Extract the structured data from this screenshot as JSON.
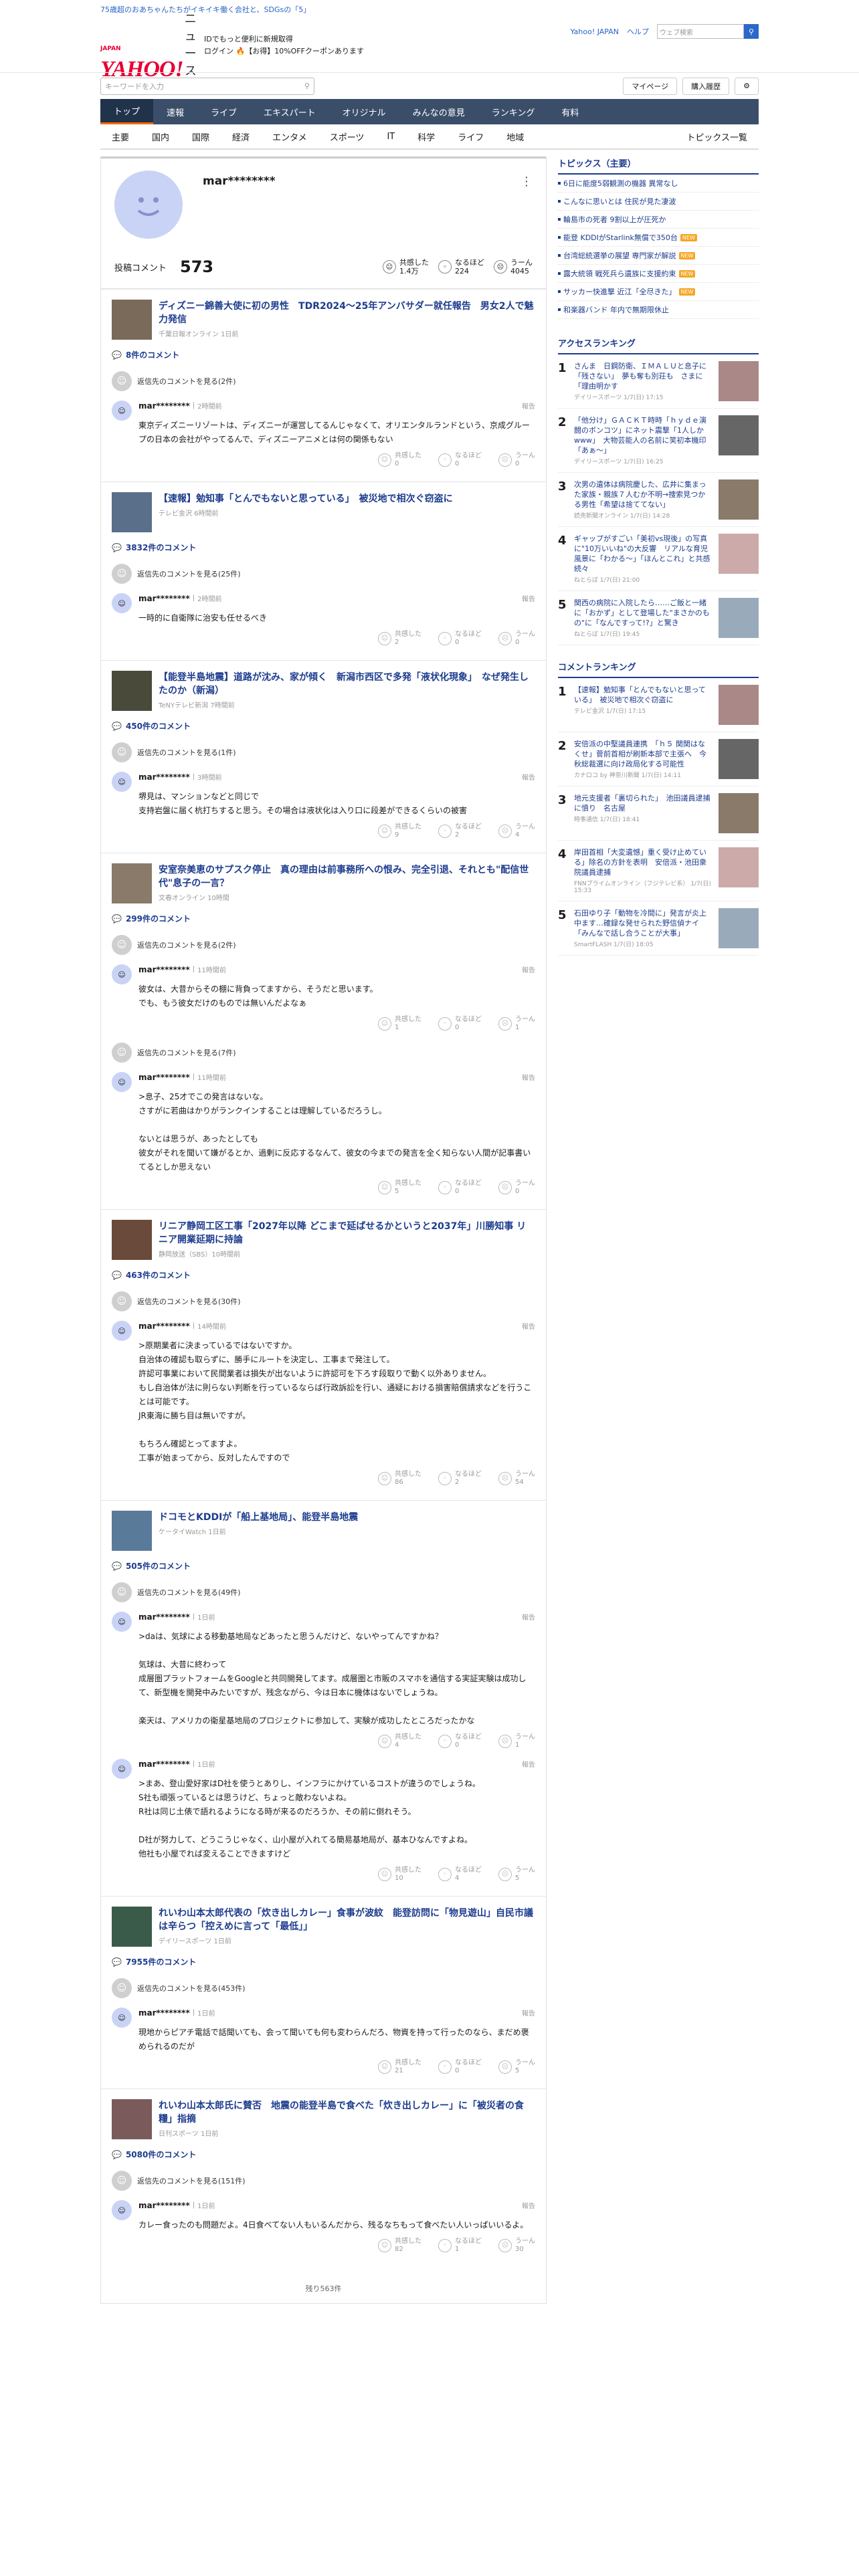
{
  "top_notice": "75歳超のおあちゃんたちがイキイキ働く会社と、SDGsの「5」",
  "header": {
    "logo_text": "YAHOO!",
    "logo_sub": "JAPAN",
    "logo_news": "ニュース",
    "promo_line1": "IDでもっと便利に新規取得",
    "promo_line2": "ログイン 🔥【お得】10%OFFクーポンあります",
    "links": [
      "Yahoo! JAPAN",
      "ヘルプ"
    ],
    "search_placeholder": "ウェブ検索"
  },
  "search": {
    "placeholder": "キーワードを入力",
    "mypage": "マイページ",
    "purchase": "購入履歴"
  },
  "nav1": [
    "トップ",
    "速報",
    "ライブ",
    "エキスパート",
    "オリジナル",
    "みんなの意見",
    "ランキング",
    "有料"
  ],
  "nav2": [
    "主要",
    "国内",
    "国際",
    "経済",
    "エンタメ",
    "スポーツ",
    "IT",
    "科学",
    "ライフ",
    "地域"
  ],
  "nav2_all": "トピックス一覧",
  "profile": {
    "username": "mar********",
    "post_label": "投稿コメント",
    "post_count": "573",
    "agree_label": "共感した",
    "agree_count": "1.4万",
    "naruhodo_label": "なるほど",
    "naruhodo_count": "224",
    "uun_label": "うーん",
    "uun_count": "4045"
  },
  "articles": [
    {
      "title": "ディズニー錦善大使に初の男性　TDR2024～25年アンバサダー就任報告　男女2人で魅力発信",
      "source": "千葉日報オンライン 1日前",
      "count": "8件のコメント",
      "replies": "返信先のコメントを見る(2件)",
      "comments": [
        {
          "user": "mar********",
          "time": "2時間前",
          "body": "東京ディズニーリゾートは、ディズニーが運営してるんじゃなくて、オリエンタルランドという、京成グループの日本の会社がやってるんで、ディズニーアニメとは何の関係もない",
          "a": "0",
          "n": "0",
          "u": "0"
        }
      ]
    },
    {
      "title": "【速報】勉知事「とんでもないと思っている」　被災地で相次ぐ窃盗に",
      "source": "テレビ金沢 6時間前",
      "count": "3832件のコメント",
      "replies": "返信先のコメントを見る(25件)",
      "comments": [
        {
          "user": "mar********",
          "time": "2時間前",
          "body": "一時的に自衛隊に治安も任せるべき",
          "a": "2",
          "n": "0",
          "u": "0"
        }
      ]
    },
    {
      "title": "【能登半島地震】道路が沈み、家が傾く　新潟市西区で多発「液状化現象」　なぜ発生したのか（新潟）",
      "source": "TeNYテレビ新潟 7時間前",
      "count": "450件のコメント",
      "replies": "返信先のコメントを見る(1件)",
      "comments": [
        {
          "user": "mar********",
          "time": "3時間前",
          "body": "堺見は、マンションなどと同じで\n支持岩盤に届く杭打ちすると思う。その場合は液状化は入り口に段差ができるくらいの被害",
          "a": "9",
          "n": "2",
          "u": "4"
        }
      ]
    },
    {
      "title": "安室奈美恵のサプスク停止　真の理由は前事務所への恨み、完全引退、それとも\"配信世代\"息子の一言？",
      "source": "文春オンライン 10時間",
      "count": "299件のコメント",
      "replies": "返信先のコメントを見る(2件)",
      "comments": [
        {
          "user": "mar********",
          "time": "11時間前",
          "body": "彼女は、大昔からその棚に背負ってますから、そうだと思います。\nでも、もう彼女だけのものでは無いんだよなぁ",
          "a": "1",
          "n": "0",
          "u": "1"
        }
      ],
      "replies2": "返信先のコメントを見る(7件)",
      "comments2": [
        {
          "user": "mar********",
          "time": "11時間前",
          "body": ">息子、25才でこの発言はないな。\nさすがに若曲はかりがランクインすることは理解しているだろうし。\n\nないとは思うが、あったとしても\n彼女がそれを聞いて嫌がるとか、過剰に反応するなんて、彼女の今までの発言を全く知らない人間が記事書いてるとしか思えない",
          "a": "5",
          "n": "0",
          "u": "0"
        }
      ]
    },
    {
      "title": "リニア静岡工区工事「2027年以降 どこまで延ばせるかというと2037年」川勝知事 リニア開業延期に持論",
      "source": "静岡放送（SBS）10時間前",
      "count": "463件のコメント",
      "replies": "返信先のコメントを見る(30件)",
      "comments": [
        {
          "user": "mar********",
          "time": "14時間前",
          "body": ">原期業者に決まっているではないですか。\n自治体の確認も取らずに、勝手にルートを決定し、工事まで発注して。\n許認可事業において民間業者は損失が出ないように許認可を下ろす段取りで動く以外ありません。\nもし自治体が法に則らない判断を行っているならば行政訴訟を行い、通疑における損害賠償請求などを行うことは可能です。\nJR東海に勝ち目は無いですが。\n\nもちろん確認とってますよ。\n工事が始まってから、反対したんですので",
          "a": "86",
          "n": "2",
          "u": "54"
        }
      ]
    },
    {
      "title": "ドコモとKDDIが「船上基地局」、能登半島地震",
      "source": "ケータイWatch 1日前",
      "count": "505件のコメント",
      "replies": "返信先のコメントを見る(49件)",
      "comments": [
        {
          "user": "mar********",
          "time": "1日前",
          "body": ">daは、気球による移動基地局などあったと思うんだけど、ないやってんですかね？\n\n気球は、大昔に終わって\n成層圏プラットフォームをGoogleと共同開発してます。成層圏と市販のスマホを通信する実証実験は成功して、新型機を開発中みたいですが、残念ながら、今は日本に機体はないでしょうね。\n\n楽天は、アメリカの衛星基地局のプロジェクトに参加して、実験が成功したところだったかな",
          "a": "4",
          "n": "0",
          "u": "1"
        },
        {
          "user": "mar********",
          "time": "1日前",
          "body": ">まあ、登山愛好家はD社を使うとありし、インフラにかけているコストが違うのでしょうね。\nS社も頑張っているとは思うけど、ちょっと敵わないよね。\nR社は同じ土俵で語れるようになる時が来るのだろうか、その前に倒れそう。\n\nD社が努力して、どうこうじゃなく、山小屋が入れてる簡易基地局が、基本ひなんですよね。\n他社も小屋でれば変えることできますけど",
          "a": "10",
          "n": "4",
          "u": "5"
        }
      ]
    },
    {
      "title": "れいわ山本太郎代表の「炊き出しカレー」食事が波紋　能登訪問に「物見遊山」自民市議は辛らつ「控えめに言って「最低」」",
      "source": "デイリースポーツ 1日前",
      "count": "7955件のコメント",
      "replies": "返信先のコメントを見る(453件)",
      "comments": [
        {
          "user": "mar********",
          "time": "1日前",
          "body": "現地からピアチ電話で話聞いても、会って聞いても何も変わらんだろ、物資を持って行ったのなら、まだめ褒められるのだが",
          "a": "21",
          "n": "0",
          "u": "5"
        }
      ]
    },
    {
      "title": "れいわ山本太郎氏に賛否　地震の能登半島で食べた「炊き出しカレー」に「被災者の食糧」指摘",
      "source": "日刊スポーツ 1日前",
      "count": "5080件のコメント",
      "replies": "返信先のコメントを見る(151件)",
      "comments": [
        {
          "user": "mar********",
          "time": "1日前",
          "body": "カレー食ったのも問題だよ。4日食べてない人もいるんだから、残るなちもって食べたい人いっぱいいるよ。",
          "a": "82",
          "n": "1",
          "u": "30"
        }
      ]
    }
  ],
  "footer": "残り563件",
  "reaction_labels": {
    "agree": "共感した",
    "naruhodo": "なるほど",
    "uun": "うーん",
    "report": "報告"
  },
  "sidebar": {
    "topics_title": "トピックス（主要）",
    "topics": [
      {
        "t": "6日に能度5弱観測の機器 異常なし",
        "new": ""
      },
      {
        "t": "こんなに思いとは 住民が見た凄波",
        "new": ""
      },
      {
        "t": "輪島市の死者 9割以上が圧死か",
        "new": ""
      },
      {
        "t": "能登 KDDIがStarlink無償で350台",
        "new": "NEW"
      },
      {
        "t": "台湾総統選挙の展望 専門家が解説",
        "new": "NEW"
      },
      {
        "t": "露大統領 戦死兵ら遺族に支援約束",
        "new": "NEW"
      },
      {
        "t": "サッカー快進撃 近江「全尽きた」",
        "new": "NEW"
      },
      {
        "t": "和楽器バンド 年内で無期限休止",
        "new": ""
      }
    ],
    "access_title": "アクセスランキング",
    "access": [
      {
        "t": "さんま　日鋼防衛、ＩＭＡＬＵと息子に「残さない」　夢も奪も別荘も　さまに「理由明かす",
        "s": "デイリースポーツ 1/7(日) 17:15"
      },
      {
        "t": "「他分け」ＧＡＣＫＴ時時「ｈｙｄｅ演闘のボンコツ」にネット震撃「1人しかwww」　大物芸能人の名前に笑初本機印「あぁ～」",
        "s": "デイリースポーツ 1/7(日) 16:25"
      },
      {
        "t": "次男の遺体は病院慶した、広井に集まった家族・親族７人むか不明→捜索見つかる男性「希望は捨ててない」",
        "s": "読売新聞オンライン 1/7(日) 14:28"
      },
      {
        "t": "ギャップがすごい「美初vs現後」の写真に\"10万いいね\"の大反響　リアルな育児風景に「わかる～」「ほんとこれ」と共感続々",
        "s": "ねとらぼ 1/7(日) 21:00"
      },
      {
        "t": "関西の病院に入院したら……ご飯と一緒に「おかず」として登場した\"まさかのもの\"に「なんですって!?」と驚き",
        "s": "ねとらぼ 1/7(日) 19:45"
      }
    ],
    "comment_title": "コメントランキング",
    "commentr": [
      {
        "t": "【速報】勉知事「とんでもないと思っている」　被災地で相次ぐ窃盗に",
        "s": "テレビ金沢 1/7(日) 17:15"
      },
      {
        "t": "安倍派の中堅議員連携　「ｈ５ 関関はなくせ」菅前首相が刷新本部で主張へ　今秋総裁選に向け政局化する可能性",
        "s": "カナロコ by 神奈川新聞 1/7(日) 14:11"
      },
      {
        "t": "地元支援者「裏切られた」　池田議員逮捕に憤り　名古屋",
        "s": "時事通信 1/7(日) 18:41"
      },
      {
        "t": "岸田首相「大変遺憾」重く受け止めている」除名の方針を表明　安倍派・池田衆院議員逮捕",
        "s": "FNNプライムオンライン（フジテレビ系） 1/7(日) 15:33"
      },
      {
        "t": "石田ゆり子「動物を冷間に」発言が炎上中ます…確録な発せられた野信偵ナイ「みんなで話し合うことが大事」",
        "s": "SmartFLASH 1/7(日) 18:05"
      }
    ]
  },
  "colors": {
    "accent": "#1d3c8e",
    "nav": "#3a4e6a",
    "brand": "#e60033"
  }
}
